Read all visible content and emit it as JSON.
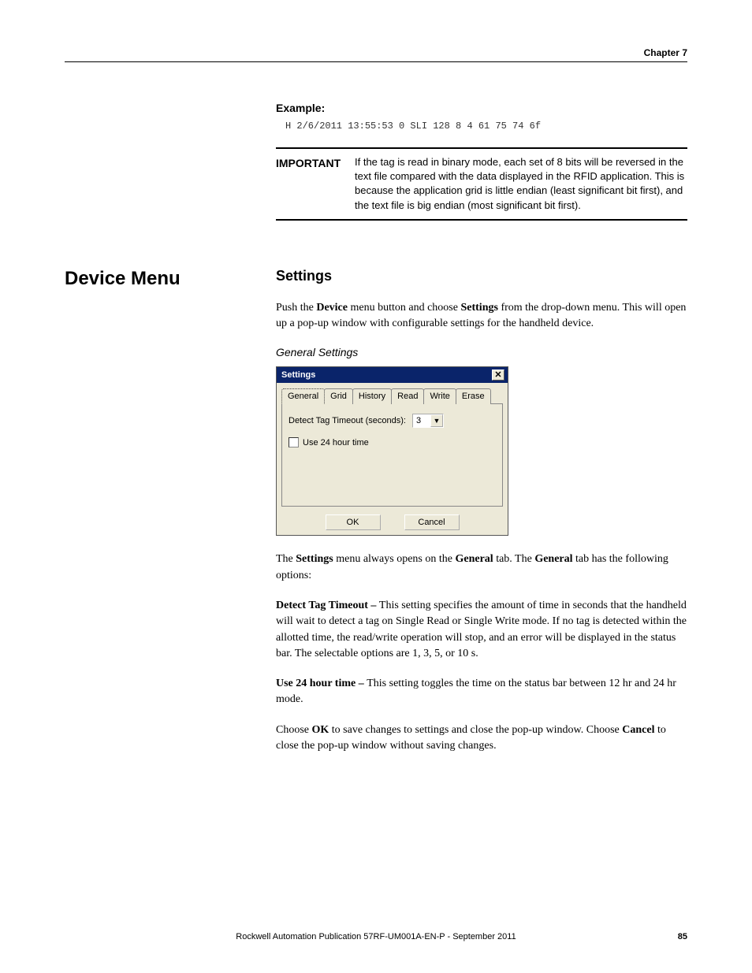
{
  "header": {
    "chapter": "Chapter 7"
  },
  "example": {
    "label": "Example:",
    "code": "H 2/6/2011 13:55:53 0 SLI 128 8 4 61 75 74 6f"
  },
  "important": {
    "label": "IMPORTANT",
    "text": "If the tag is read in binary mode, each set of 8 bits will be reversed in the text file compared with the data displayed in the RFID application. This is because the application grid is little endian (least significant bit first), and the text file is big endian (most significant bit first)."
  },
  "leftHeading": "Device Menu",
  "settings": {
    "heading": "Settings",
    "para1_pre": "Push the ",
    "para1_b1": "Device",
    "para1_mid": " menu button and choose ",
    "para1_b2": "Settings",
    "para1_post": " from the drop-down menu. This will open up a pop-up window with configurable settings for the handheld device.",
    "subheading": "General Settings"
  },
  "dialog": {
    "title": "Settings",
    "close": "✕",
    "tabs": [
      "General",
      "Grid",
      "History",
      "Read",
      "Write",
      "Erase"
    ],
    "detectLabel": "Detect Tag Timeout (seconds):",
    "detectValue": "3",
    "dropdownArrow": "▼",
    "checkboxLabel": "Use 24 hour time",
    "ok": "OK",
    "cancel": "Cancel"
  },
  "afterDialog": {
    "p1_a": "The ",
    "p1_b1": "Settings",
    "p1_b": " menu always opens on the ",
    "p1_b2": "General",
    "p1_c": " tab. The ",
    "p1_b3": "General",
    "p1_d": " tab has the following options:",
    "p2_b": "Detect Tag Timeout – ",
    "p2_t": "This setting specifies the amount of time in seconds that the handheld will wait to detect a tag on Single Read or Single Write mode. If no tag is detected within the allotted time, the read/write operation will stop, and an error will be displayed in the status bar. The selectable options are 1, 3, 5, or 10 s.",
    "p3_b": "Use 24 hour time – ",
    "p3_t": "This setting toggles the time on the status bar between 12 hr and 24 hr mode.",
    "p4_a": "Choose ",
    "p4_b1": "OK",
    "p4_b": " to save changes to settings and close the pop-up window. Choose ",
    "p4_b2": "Cancel",
    "p4_c": " to close the pop-up window without saving changes."
  },
  "footer": {
    "pub": "Rockwell Automation Publication 57RF-UM001A-EN-P - September 2011",
    "page": "85"
  }
}
